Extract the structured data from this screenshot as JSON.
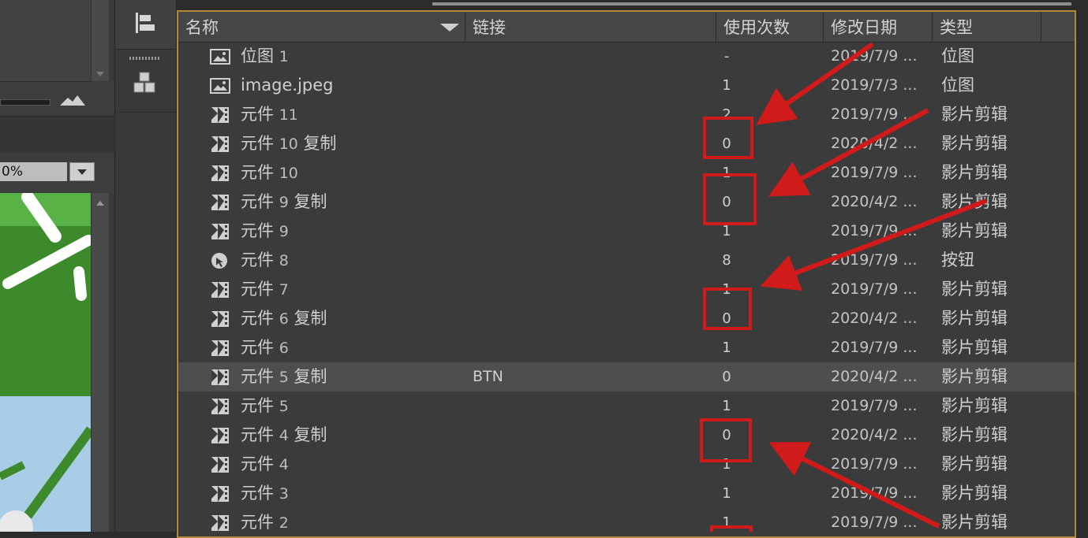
{
  "left_panel": {
    "zoom_value": "0%"
  },
  "library": {
    "columns": {
      "name": "名称",
      "link": "链接",
      "uses": "使用次数",
      "modified": "修改日期",
      "type": "类型"
    },
    "rows": [
      {
        "name": "位图",
        "num": "1",
        "suffix": "",
        "link": "",
        "uses": "-",
        "date": "2019/7/9 ...",
        "type": "位图",
        "icon": "bitmap-icon"
      },
      {
        "name": "image.jpeg",
        "num": "",
        "suffix": "",
        "link": "",
        "uses": "1",
        "date": "2019/7/3 ...",
        "type": "位图",
        "icon": "bitmap-icon"
      },
      {
        "name": "元件",
        "num": "11",
        "suffix": "",
        "link": "",
        "uses": "2",
        "date": "2019/7/9 ...",
        "type": "影片剪辑",
        "icon": "movieclip-icon"
      },
      {
        "name": "元件",
        "num": "10",
        "suffix": "复制",
        "link": "",
        "uses": "0",
        "date": "2020/4/2 ...",
        "type": "影片剪辑",
        "icon": "movieclip-icon"
      },
      {
        "name": "元件",
        "num": "10",
        "suffix": "",
        "link": "",
        "uses": "1",
        "date": "2019/7/9 ...",
        "type": "影片剪辑",
        "icon": "movieclip-icon"
      },
      {
        "name": "元件",
        "num": "9",
        "suffix": "复制",
        "link": "",
        "uses": "0",
        "date": "2020/4/2 ...",
        "type": "影片剪辑",
        "icon": "movieclip-icon"
      },
      {
        "name": "元件",
        "num": "9",
        "suffix": "",
        "link": "",
        "uses": "1",
        "date": "2019/7/9 ...",
        "type": "影片剪辑",
        "icon": "movieclip-icon"
      },
      {
        "name": "元件",
        "num": "8",
        "suffix": "",
        "link": "",
        "uses": "8",
        "date": "2019/7/9 ...",
        "type": "按钮",
        "icon": "button-symbol-icon"
      },
      {
        "name": "元件",
        "num": "7",
        "suffix": "",
        "link": "",
        "uses": "1",
        "date": "2019/7/9 ...",
        "type": "影片剪辑",
        "icon": "movieclip-icon"
      },
      {
        "name": "元件",
        "num": "6",
        "suffix": "复制",
        "link": "",
        "uses": "0",
        "date": "2020/4/2 ...",
        "type": "影片剪辑",
        "icon": "movieclip-icon"
      },
      {
        "name": "元件",
        "num": "6",
        "suffix": "",
        "link": "",
        "uses": "1",
        "date": "2019/7/9 ...",
        "type": "影片剪辑",
        "icon": "movieclip-icon"
      },
      {
        "name": "元件",
        "num": "5",
        "suffix": "复制",
        "link": "BTN",
        "uses": "0",
        "date": "2020/4/2 ...",
        "type": "影片剪辑",
        "icon": "movieclip-icon",
        "selected": true
      },
      {
        "name": "元件",
        "num": "5",
        "suffix": "",
        "link": "",
        "uses": "1",
        "date": "2019/7/9 ...",
        "type": "影片剪辑",
        "icon": "movieclip-icon"
      },
      {
        "name": "元件",
        "num": "4",
        "suffix": "复制",
        "link": "",
        "uses": "0",
        "date": "2020/4/2 ...",
        "type": "影片剪辑",
        "icon": "movieclip-icon"
      },
      {
        "name": "元件",
        "num": "4",
        "suffix": "",
        "link": "",
        "uses": "1",
        "date": "2019/7/9 ...",
        "type": "影片剪辑",
        "icon": "movieclip-icon"
      },
      {
        "name": "元件",
        "num": "3",
        "suffix": "",
        "link": "",
        "uses": "1",
        "date": "2019/7/9 ...",
        "type": "影片剪辑",
        "icon": "movieclip-icon"
      },
      {
        "name": "元件",
        "num": "2",
        "suffix": "",
        "link": "",
        "uses": "1",
        "date": "2019/7/9 ...",
        "type": "影片剪辑",
        "icon": "movieclip-icon"
      }
    ]
  },
  "annotation_colors": {
    "arrow": "#d11a1a",
    "highlight_box": "#d11a1a"
  }
}
